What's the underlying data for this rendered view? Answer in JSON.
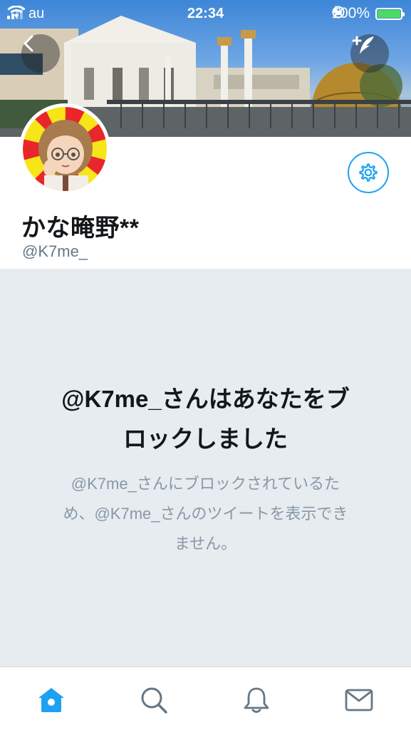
{
  "status_bar": {
    "carrier": "au",
    "time": "22:34",
    "battery_percent": "100%",
    "battery_level": 1.0,
    "icons": [
      "signal-icon",
      "wifi-icon",
      "rotation-lock-icon",
      "battery-icon",
      "charging-icon"
    ]
  },
  "header": {
    "back_icon": "chevron-left-icon",
    "compose_icon": "compose-tweet-icon",
    "settings_icon": "gear-icon"
  },
  "profile": {
    "display_name": "かな晻野**",
    "handle": "@K7me_"
  },
  "blocked": {
    "title_line1": "@K7me_さんはあなたをブ",
    "title_line2": "ロックしました",
    "description_line1": "@K7me_さんにブロックされているた",
    "description_line2": "め、@K7me_さんのツイートを表示でき",
    "description_line3": "ません。"
  },
  "tab_bar": {
    "tabs": [
      {
        "icon": "home-icon",
        "active": true
      },
      {
        "icon": "search-icon",
        "active": false
      },
      {
        "icon": "bell-icon",
        "active": false
      },
      {
        "icon": "mail-icon",
        "active": false
      }
    ]
  },
  "colors": {
    "accent": "#1da1f2",
    "panel_background": "#e6ecf0",
    "secondary_text": "#657786",
    "inactive_icon": "#657786"
  }
}
